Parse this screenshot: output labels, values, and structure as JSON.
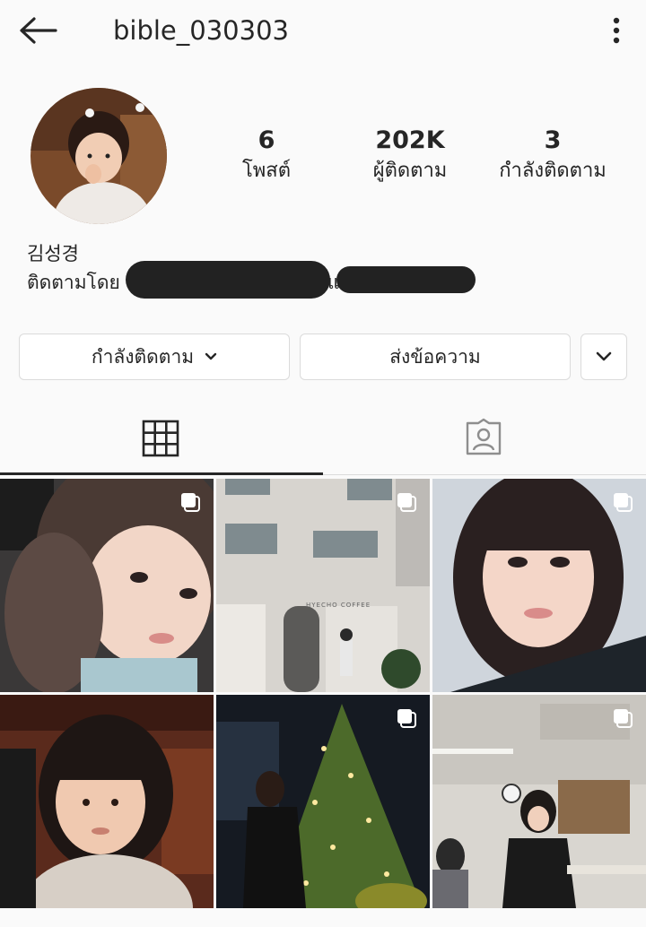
{
  "header": {
    "username": "bible_030303",
    "back_icon": "arrow-left-icon",
    "more_icon": "more-vertical-icon"
  },
  "profile": {
    "avatar_icon": "profile-photo",
    "stats": [
      {
        "value": "6",
        "label": "โพสต์"
      },
      {
        "value": "202K",
        "label": "ผู้ติดตาม"
      },
      {
        "value": "3",
        "label": "กำลังติดตาม"
      }
    ],
    "name": "김성경",
    "followed_by_prefix": "ติดตามโดย",
    "followed_by_joiner": "แ"
  },
  "actions": {
    "following_label": "กำลังติดตาม",
    "message_label": "ส่งข้อความ"
  },
  "tabs": {
    "grid_icon": "grid-icon",
    "tagged_icon": "tagged-person-icon"
  },
  "grid": {
    "posts": [
      {
        "type": "selfie",
        "multi": true
      },
      {
        "type": "building",
        "sign": "HYECHO COFFEE",
        "multi": true
      },
      {
        "type": "portrait",
        "multi": true
      },
      {
        "type": "child",
        "multi": false
      },
      {
        "type": "christmas-tree",
        "multi": true
      },
      {
        "type": "classroom",
        "multi": true
      }
    ]
  },
  "colors": {
    "background": "#fafafa",
    "text": "#262626",
    "border": "#dbdbdb"
  }
}
